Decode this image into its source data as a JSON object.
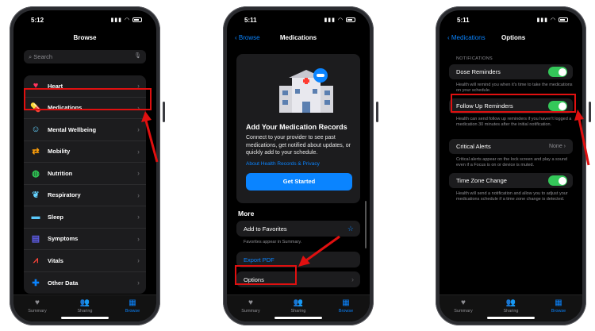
{
  "phone1": {
    "time": "5:12",
    "title": "Browse",
    "search_placeholder": "Search",
    "items": [
      {
        "label": "Heart",
        "icon": "heart-icon"
      },
      {
        "label": "Medications",
        "icon": "pills-icon"
      },
      {
        "label": "Mental Wellbeing",
        "icon": "head-icon"
      },
      {
        "label": "Mobility",
        "icon": "arrows-icon"
      },
      {
        "label": "Nutrition",
        "icon": "apple-icon"
      },
      {
        "label": "Respiratory",
        "icon": "lungs-icon"
      },
      {
        "label": "Sleep",
        "icon": "bed-icon"
      },
      {
        "label": "Symptoms",
        "icon": "clipboard-icon"
      },
      {
        "label": "Vitals",
        "icon": "chart-icon"
      },
      {
        "label": "Other Data",
        "icon": "plus-icon"
      }
    ]
  },
  "phone2": {
    "time": "5:11",
    "back": "Browse",
    "title": "Medications",
    "card_title": "Add Your Medication Records",
    "card_desc": "Connect to your provider to see past medications, get notified about updates, or quickly add to your schedule.",
    "card_link": "About Health Records & Privacy",
    "get_started": "Get Started",
    "more_header": "More",
    "add_favorites": "Add to Favorites",
    "favorites_note": "Favorites appear in Summary.",
    "export_pdf": "Export PDF",
    "options": "Options"
  },
  "phone3": {
    "time": "5:11",
    "back": "Medications",
    "title": "Options",
    "section": "NOTIFICATIONS",
    "dose_reminders": "Dose Reminders",
    "dose_note": "Health will remind you when it's time to take the medications on your schedule.",
    "follow_up": "Follow Up Reminders",
    "follow_note": "Health can send follow up reminders if you haven't logged a medication 30 minutes after the initial notification.",
    "critical": "Critical Alerts",
    "critical_value": "None",
    "critical_note": "Critical alerts appear on the lock screen and play a sound even if a Focus is on or device is muted.",
    "time_zone": "Time Zone Change",
    "tz_note": "Health will send a notification and allow you to adjust your medications schedule if a time zone change is detected."
  },
  "tabbar": {
    "summary": "Summary",
    "sharing": "Sharing",
    "browse": "Browse"
  },
  "colors": {
    "accent": "#0a84ff",
    "toggle_on": "#34c759",
    "highlight": "#e01010"
  }
}
